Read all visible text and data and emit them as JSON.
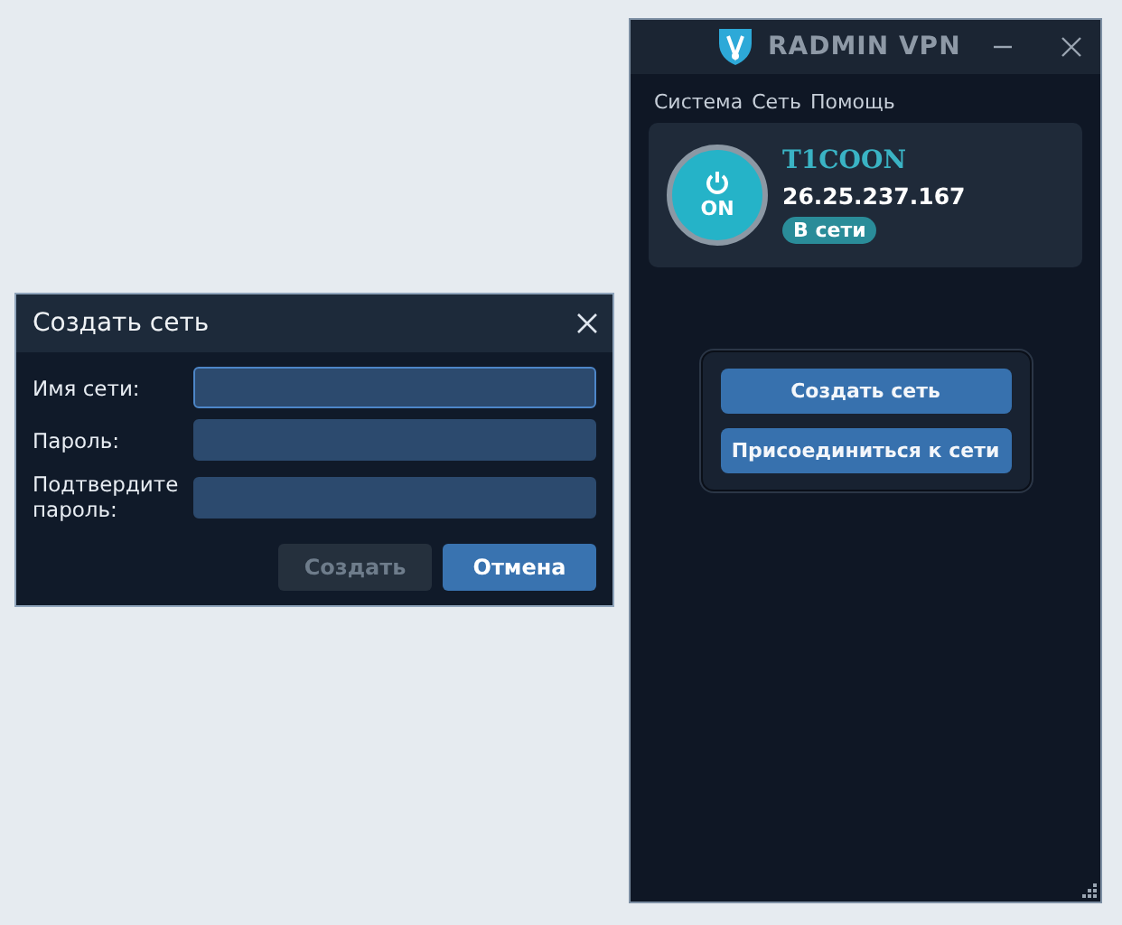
{
  "dialog": {
    "title": "Создать сеть",
    "fields": [
      {
        "label": "Имя сети:",
        "focused": true
      },
      {
        "label": "Пароль:",
        "focused": false
      },
      {
        "label": "Подтвердите пароль:",
        "focused": false
      }
    ],
    "buttons": [
      {
        "label": "Создать",
        "disabled": true
      },
      {
        "label": "Отмена",
        "disabled": false
      }
    ]
  },
  "app": {
    "title": "RADMIN VPN",
    "menu": [
      "Система",
      "Сеть",
      "Помощь"
    ],
    "profile": {
      "power_label": "ON",
      "on": true,
      "name": "T1COON",
      "ip": "26.25.237.167",
      "status": "В сети"
    },
    "actions": [
      "Создать сеть",
      "Присоединиться к сети"
    ]
  }
}
